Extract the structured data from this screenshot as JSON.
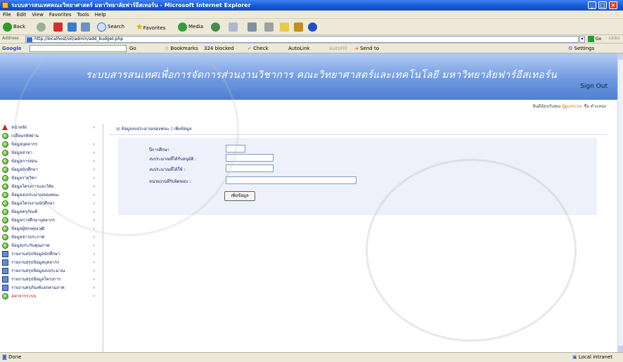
{
  "window": {
    "title": "ระบบสารสนเทศคณะวิทยาศาสตร์ มหาวิทยาลัยฟาร์อีสเทอร์น - Microsoft Internet Explorer"
  },
  "menubar": {
    "items": [
      "File",
      "Edit",
      "View",
      "Favorites",
      "Tools",
      "Help"
    ]
  },
  "toolbar": {
    "back": "Back",
    "search": "Search",
    "favorites": "Favorites",
    "media": "Media"
  },
  "address": {
    "label": "Address",
    "url": "http://localhost/oil/admin/add_budget.php",
    "go": "Go",
    "links": "Links"
  },
  "googlebar": {
    "label": "Google",
    "go": "Go",
    "bookmarks": "Bookmarks",
    "blocked": "324 blocked",
    "check": "Check",
    "autolink": "AutoLink",
    "autofill": "AutoFill",
    "sendto": "Send to",
    "settings": "Settings"
  },
  "banner": {
    "title": "ระบบสารสนเทศเพื่อการจัดการส่วนงานวิชาการ คณะวิทยาศาสตร์และเทคโนโลยี มหาวิทยาลัยฟาร์อีสเทอร์น",
    "signout": "Sign Out"
  },
  "welcome": {
    "prefix": "ยินดีต้อนรับคุณ",
    "user": "ผู้ดูแลระบบ",
    "suffix": "ชื่อ ตำแหน่ง"
  },
  "sidebar": {
    "items": [
      {
        "label": "หน้าหลัก",
        "icon": "home-icon",
        "arrow": "›"
      },
      {
        "label": "เปลี่ยนรหัสผ่าน",
        "icon": "bullet-icon",
        "arrow": ""
      },
      {
        "label": "ข้อมูลบุคลากร",
        "icon": "bullet-icon",
        "arrow": "›"
      },
      {
        "label": "ข้อมูลสาขา",
        "icon": "bullet-icon",
        "arrow": "›"
      },
      {
        "label": "ข้อมูลการสอน",
        "icon": "bullet-icon",
        "arrow": "›"
      },
      {
        "label": "ข้อมูลนักศึกษา",
        "icon": "bullet-icon",
        "arrow": "›"
      },
      {
        "label": "ข้อมูลรายวิชา",
        "icon": "bullet-icon",
        "arrow": "›"
      },
      {
        "label": "ข้อมูลโครงการและวิจัย",
        "icon": "bullet-icon",
        "arrow": "›"
      },
      {
        "label": "ข้อมูลงบประมาณของคณะ",
        "icon": "bullet-icon",
        "arrow": "›"
      },
      {
        "label": "ข้อมูลโครงงานนักศึกษา",
        "icon": "bullet-icon",
        "arrow": "›"
      },
      {
        "label": "ข้อมูลครุภัณฑ์",
        "icon": "bullet-icon",
        "arrow": "›"
      },
      {
        "label": "ข้อมูลการศึกษาบุคลากร",
        "icon": "bullet-icon",
        "arrow": "›"
      },
      {
        "label": "ข้อมูลผู้ทรงคุณวุฒิ",
        "icon": "bullet-icon",
        "arrow": "›"
      },
      {
        "label": "ข้อมูลข่าวประกาศ",
        "icon": "bullet-icon",
        "arrow": "›"
      },
      {
        "label": "ข้อมูลประกันคุณภาพ",
        "icon": "bullet-icon",
        "arrow": "›"
      },
      {
        "label": "รายงานสรุปข้อมูลนักศึกษา",
        "icon": "report-icon",
        "arrow": "›"
      },
      {
        "label": "รายงานสรุปข้อมูลบุคลากร",
        "icon": "report-icon",
        "arrow": "›"
      },
      {
        "label": "รายงานสรุปข้อมูลงบประมาณ",
        "icon": "report-icon",
        "arrow": "›"
      },
      {
        "label": "รายงานสรุปข้อมูลโครงการ",
        "icon": "report-icon",
        "arrow": "›"
      },
      {
        "label": "รายงานครุภัณฑ์แยกตามภาค",
        "icon": "report-icon",
        "arrow": "›"
      },
      {
        "label": "ออกจากระบบ",
        "icon": "bullet-icon",
        "arrow": "›"
      }
    ]
  },
  "content": {
    "breadcrumb": "ข้อมูลงบประมาณของคณะ | เพิ่มข้อมูล",
    "form": {
      "fields": [
        {
          "label": "ปีการศึกษา",
          "value": ""
        },
        {
          "label": "งบประมาณที่ได้รับอนุมัติ :",
          "value": ""
        },
        {
          "label": "งบประมาณที่ได้ใช้ :",
          "value": ""
        },
        {
          "label": "หน่วยงานที่รับผิดชอบ :",
          "value": ""
        }
      ],
      "submit": "เพิ่มข้อมูล"
    }
  },
  "status": {
    "text": "Done",
    "zone": "Local intranet"
  },
  "colors": {
    "banner": "#6f99e0",
    "titlebar": "#1556d6",
    "nav_text": "#102060",
    "logout": "#c01010"
  }
}
